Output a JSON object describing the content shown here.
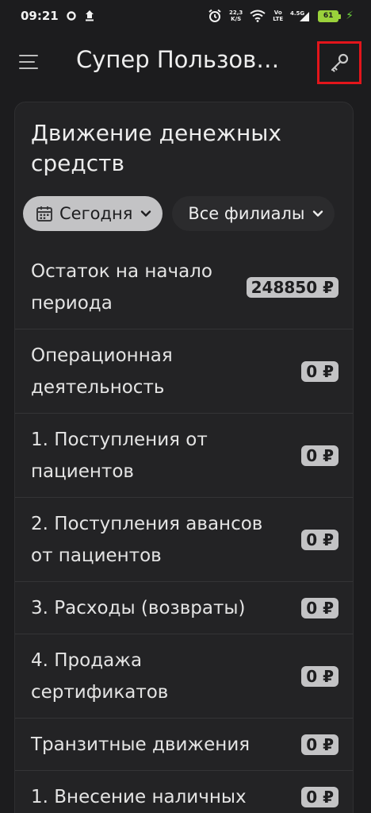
{
  "status_bar": {
    "time": "09:21",
    "net_speed_value": "22,3",
    "net_speed_unit": "K/S",
    "volte_top": "Vo",
    "volte_bottom": "LTE",
    "signal_label": "4.5G",
    "battery": "61"
  },
  "app_bar": {
    "title": "Супер Пользов…"
  },
  "card": {
    "title": "Движение денежных средств",
    "filters": {
      "date_label": "Сегодня",
      "branch_label": "Все филиалы"
    },
    "rows": [
      {
        "label": "Остаток на начало периода",
        "amount": "248850 ₽"
      },
      {
        "label": "Операционная деятельность",
        "amount": "0 ₽"
      },
      {
        "label": "1. Поступления от пациентов",
        "amount": "0 ₽"
      },
      {
        "label": "2. Поступления авансов от пациентов",
        "amount": "0 ₽"
      },
      {
        "label": "3. Расходы (возвраты)",
        "amount": "0 ₽"
      },
      {
        "label": "4. Продажа сертификатов",
        "amount": "0 ₽"
      },
      {
        "label": "Транзитные движения",
        "amount": "0 ₽"
      },
      {
        "label": "1. Внесение наличных",
        "amount": "0 ₽"
      }
    ]
  },
  "colors": {
    "background": "#1c1c1e",
    "card": "#232325",
    "chip_active": "#c3c3c5",
    "highlight": "#e3151b",
    "battery": "#9ad13b"
  }
}
